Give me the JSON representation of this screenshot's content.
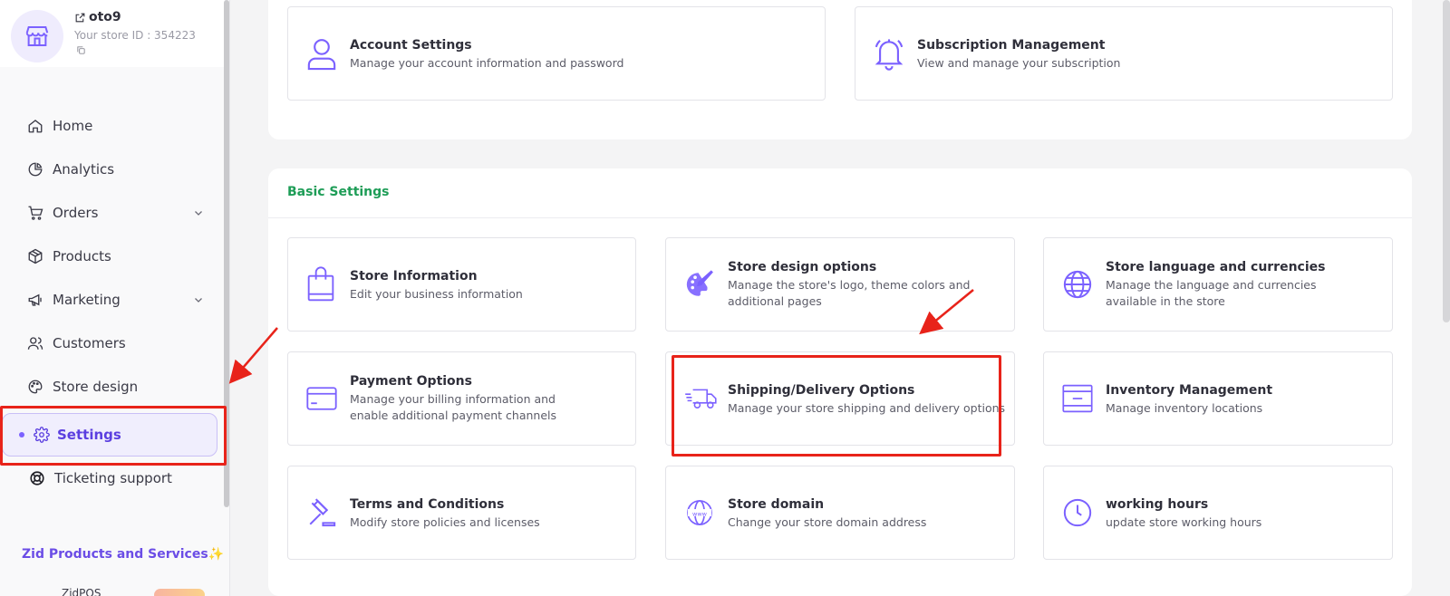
{
  "store": {
    "name": "oto9",
    "store_id_text": "Your store ID : 354223"
  },
  "sidebar": {
    "items": [
      {
        "label": "Home",
        "icon": "home-icon"
      },
      {
        "label": "Analytics",
        "icon": "pie-chart-icon"
      },
      {
        "label": "Orders",
        "icon": "cart-icon",
        "has_chevron": true
      },
      {
        "label": "Products",
        "icon": "box-icon"
      },
      {
        "label": "Marketing",
        "icon": "megaphone-icon",
        "has_chevron": true
      },
      {
        "label": "Customers",
        "icon": "users-icon"
      },
      {
        "label": "Store design",
        "icon": "palette-icon"
      },
      {
        "label": "Settings",
        "icon": "gear-icon",
        "active": true
      },
      {
        "label": "Ticketing support",
        "icon": "lifebuoy-icon"
      }
    ],
    "zid_section_title": "Zid Products and Services✨",
    "zidpos_label": "ZidPOS"
  },
  "account_cards": [
    {
      "title": "Account Settings",
      "desc": "Manage your account information and password",
      "icon": "user-icon"
    },
    {
      "title": "Subscription Management",
      "desc": "View and manage your subscription",
      "icon": "bell-icon"
    }
  ],
  "basic_settings": {
    "title": "Basic Settings",
    "cards": [
      {
        "title": "Store Information",
        "desc": "Edit your business information",
        "icon": "shopping-bag-icon"
      },
      {
        "title": "Store design options",
        "desc": "Manage the store's logo, theme colors and additional pages",
        "icon": "palette-icon"
      },
      {
        "title": "Store language and currencies",
        "desc": "Manage the language and currencies available in the store",
        "icon": "globe-icon"
      },
      {
        "title": "Payment Options",
        "desc": "Manage your billing information and enable additional payment channels",
        "icon": "credit-card-icon"
      },
      {
        "title": "Shipping/Delivery Options",
        "desc": "Manage your store shipping and delivery options",
        "icon": "delivery-truck-icon"
      },
      {
        "title": "Inventory Management",
        "desc": "Manage inventory locations",
        "icon": "warehouse-icon"
      },
      {
        "title": "Terms and Conditions",
        "desc": "Modify store policies and licenses",
        "icon": "gavel-icon"
      },
      {
        "title": "Store domain",
        "desc": "Change your store domain address",
        "icon": "domain-globe-icon"
      },
      {
        "title": "working hours",
        "desc": "update store working hours",
        "icon": "clock-icon"
      }
    ]
  },
  "colors": {
    "accent": "#7b61ff",
    "section_green": "#1e9d57",
    "annotation_red": "#e8231a"
  }
}
